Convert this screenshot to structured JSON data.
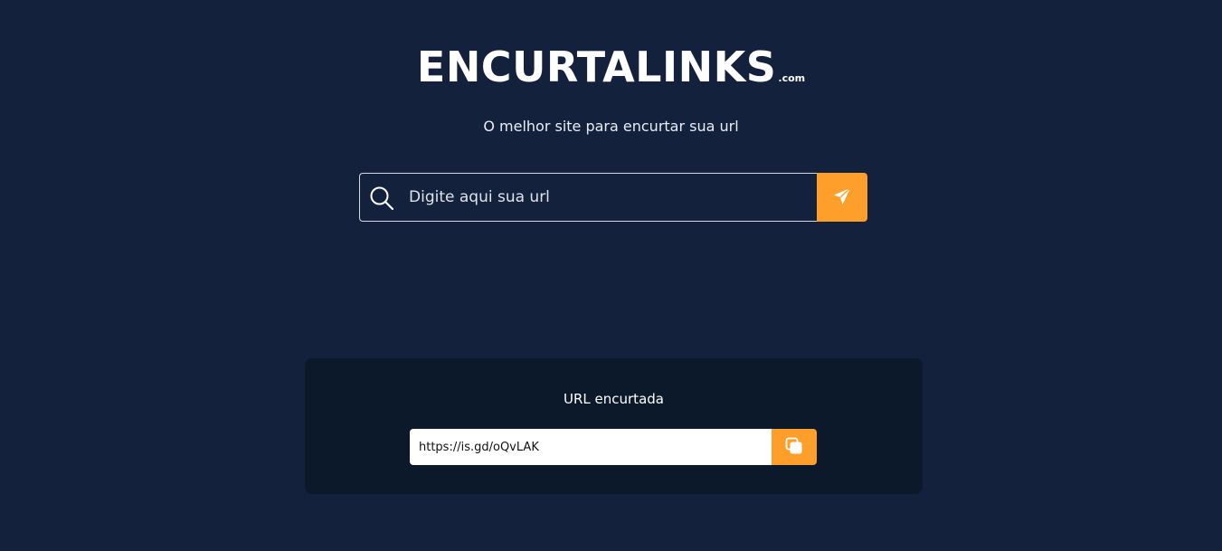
{
  "header": {
    "logo_text": "ENCURTALINKS",
    "logo_suffix": ".com",
    "tagline": "O melhor site para encurtar sua url"
  },
  "search": {
    "placeholder": "Digite aqui sua url",
    "value": "",
    "icon": "search-icon",
    "submit_icon": "send-icon"
  },
  "result": {
    "title": "URL encurtada",
    "short_url": "https://is.gd/oQvLAK",
    "copy_icon": "copy-icon"
  },
  "colors": {
    "background": "#13213c",
    "card_background": "#0c192b",
    "accent": "#fe9f2b",
    "text": "#ffffff"
  }
}
